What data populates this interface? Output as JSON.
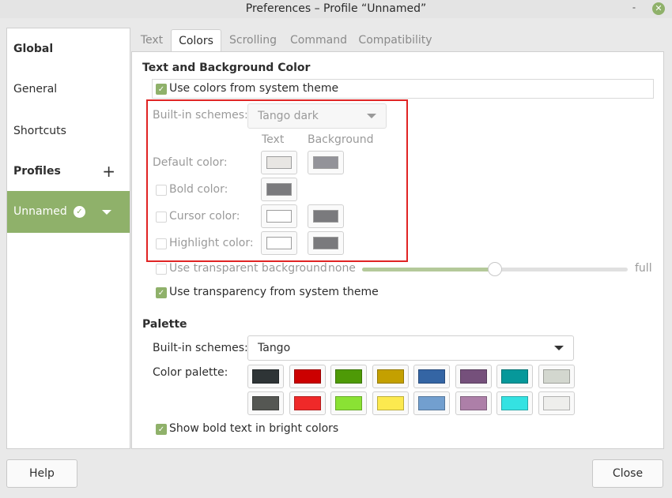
{
  "window": {
    "title": "Preferences – Profile “Unnamed”",
    "minimize_glyph": "˗",
    "close_glyph": "✕"
  },
  "sidebar": {
    "global_label": "Global",
    "general_label": "General",
    "shortcuts_label": "Shortcuts",
    "profiles_label": "Profiles",
    "add_glyph": "+",
    "profile_name": "Unnamed",
    "profile_default_glyph": "✓"
  },
  "tabs": [
    {
      "label": "Text",
      "active": false
    },
    {
      "label": "Colors",
      "active": true
    },
    {
      "label": "Scrolling",
      "active": false
    },
    {
      "label": "Command",
      "active": false
    },
    {
      "label": "Compatibility",
      "active": false
    }
  ],
  "colors_tab": {
    "section_title": "Text and Background Color",
    "use_system_colors": {
      "label": "Use colors from system theme",
      "checked": true
    },
    "builtin_schemes_label": "Built-in schemes:",
    "builtin_scheme_value": "Tango dark",
    "col_text": "Text",
    "col_background": "Background",
    "default_color": {
      "label": "Default color:",
      "text": "#e8e6e3",
      "background": "#939399"
    },
    "bold_color": {
      "label": "Bold color:",
      "checked": false,
      "text": "#7a7a7d"
    },
    "cursor_color": {
      "label": "Cursor color:",
      "checked": false,
      "text": "#ffffff",
      "background": "#7a7a7d"
    },
    "highlight_color": {
      "label": "Highlight color:",
      "checked": false,
      "text": "#ffffff",
      "background": "#7a7a7d"
    },
    "transparent_bg": {
      "label": "Use transparent background",
      "checked": false,
      "min_label": "none",
      "max_label": "full",
      "level": 0.5
    },
    "transparency_system": {
      "label": "Use transparency from system theme",
      "checked": true
    }
  },
  "palette": {
    "section_title": "Palette",
    "builtin_schemes_label": "Built-in schemes:",
    "builtin_scheme_value": "Tango",
    "color_palette_label": "Color palette:",
    "row1": [
      "#2e3436",
      "#cc0000",
      "#4e9a06",
      "#c4a000",
      "#3465a4",
      "#75507b",
      "#06989a",
      "#d3d7cf"
    ],
    "row2": [
      "#555753",
      "#ef2929",
      "#8ae234",
      "#fce94f",
      "#729fcf",
      "#ad7fa8",
      "#34e2e2",
      "#eeeeec"
    ],
    "bold_bright": {
      "label": "Show bold text in bright colors",
      "checked": true
    }
  },
  "footer": {
    "help_label": "Help",
    "close_label": "Close"
  }
}
